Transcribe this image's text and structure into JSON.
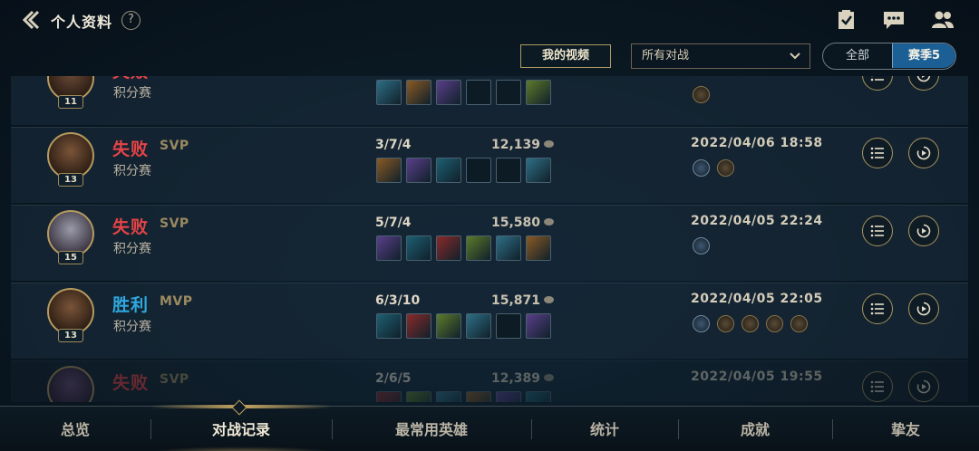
{
  "header": {
    "title": "个人资料",
    "help": "?",
    "icons": [
      "checklist-icon",
      "chat-icon",
      "friends-icon"
    ]
  },
  "filters": {
    "video_button": "我的视频",
    "match_select": "所有对战",
    "segment": {
      "all": "全部",
      "season": "赛季5",
      "selected": "season"
    }
  },
  "matches": [
    {
      "level": "11",
      "result": "失败",
      "outcome": "lose",
      "badge": "",
      "mode": "积分赛",
      "kda": "",
      "gold": "",
      "date": "",
      "items": 6,
      "medals": [
        "bronze"
      ]
    },
    {
      "level": "13",
      "result": "失败",
      "outcome": "lose",
      "badge": "SVP",
      "mode": "积分赛",
      "kda": "3/7/4",
      "gold": "12,139",
      "date": "2022/04/06 18:58",
      "items": 6,
      "medals": [
        "blue",
        "bronze"
      ]
    },
    {
      "level": "15",
      "result": "失败",
      "outcome": "lose",
      "badge": "SVP",
      "mode": "积分赛",
      "kda": "5/7/4",
      "gold": "15,580",
      "date": "2022/04/05 22:24",
      "items": 6,
      "medals": [
        "blue"
      ]
    },
    {
      "level": "13",
      "result": "胜利",
      "outcome": "win",
      "badge": "MVP",
      "mode": "积分赛",
      "kda": "6/3/10",
      "gold": "15,871",
      "date": "2022/04/05 22:05",
      "items": 6,
      "medals": [
        "gold",
        "blue",
        "bronze",
        "bronze",
        "bronze",
        "bronze"
      ]
    },
    {
      "level": "",
      "result": "失败",
      "outcome": "lose",
      "badge": "SVP",
      "mode": "",
      "kda": "2/6/5",
      "gold": "12,389",
      "date": "2022/04/05 19:55",
      "items": 6,
      "medals": []
    }
  ],
  "nav": {
    "items": [
      "总览",
      "对战记录",
      "最常用英雄",
      "统计",
      "成就",
      "挚友"
    ],
    "active": 1
  },
  "colors": {
    "lose": "#e54447",
    "win": "#2ea8df",
    "accent": "#c8a861",
    "segment_active": "#1c5f95"
  }
}
